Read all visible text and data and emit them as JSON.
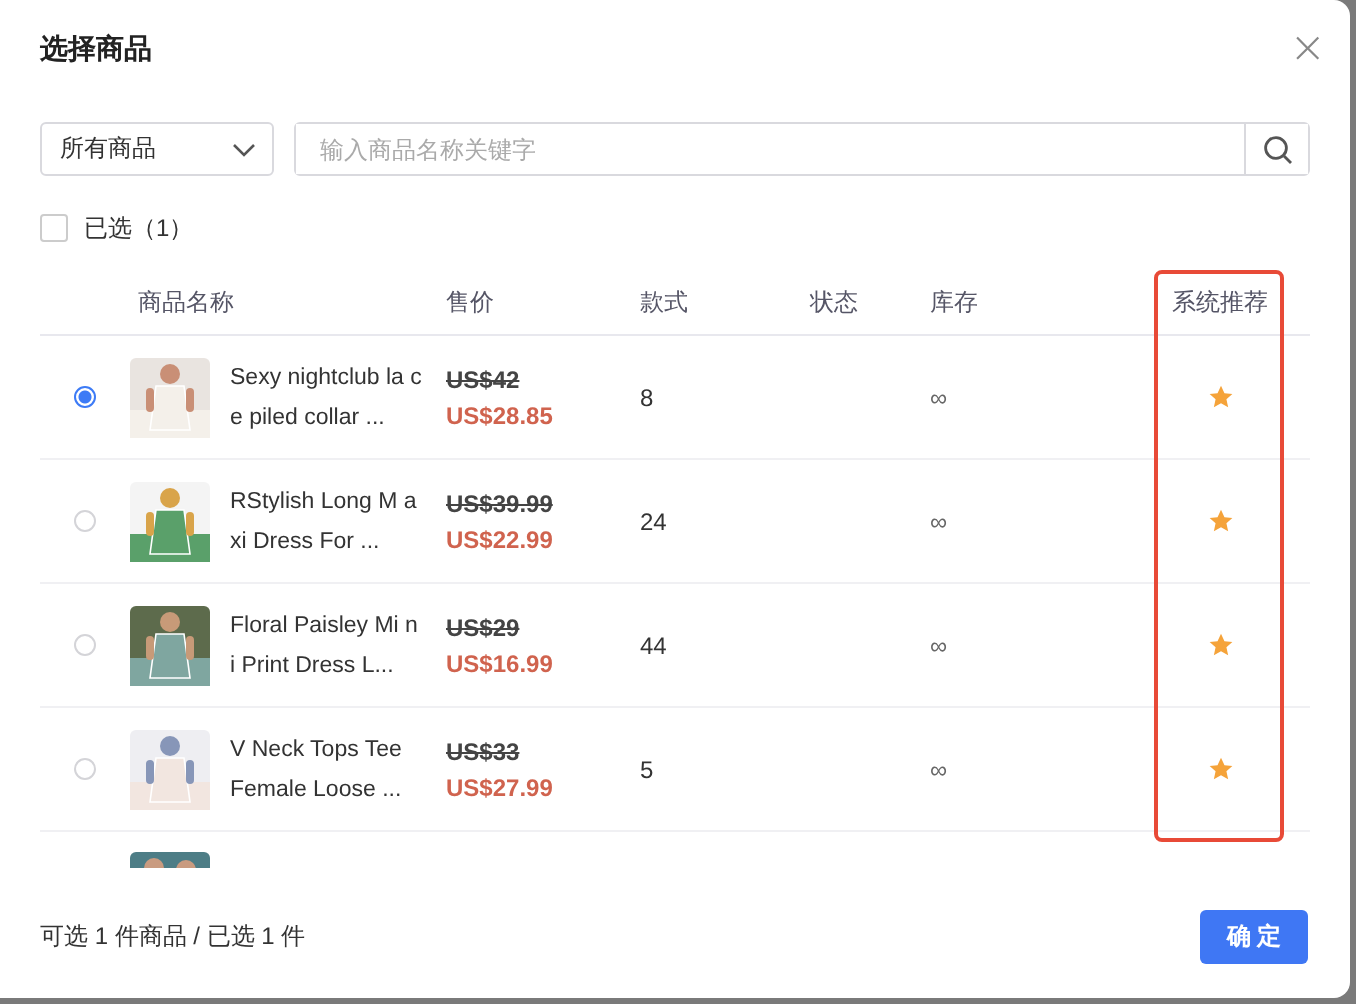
{
  "dialog": {
    "title": "选择商品",
    "close": "×"
  },
  "filter": {
    "category": "所有商品",
    "search_placeholder": "输入商品名称关键字"
  },
  "select_all": {
    "label": "已选（1）",
    "checked": false
  },
  "table": {
    "columns": [
      {
        "label": "商品名称",
        "highlighted": false
      },
      {
        "label": "售价",
        "highlighted": false
      },
      {
        "label": "款式",
        "highlighted": false
      },
      {
        "label": "状态",
        "highlighted": false
      },
      {
        "label": "库存",
        "highlighted": false
      },
      {
        "label": "系统推荐",
        "highlighted": true
      }
    ],
    "rows": [
      {
        "selected": true,
        "name": "Sexy nightclub la ce piled collar ...",
        "original_price": "US$42",
        "price": "US$28.85",
        "styles": "8",
        "stock": "∞",
        "recommended": true
      },
      {
        "selected": false,
        "name": "RStylish Long M axi Dress For ...",
        "original_price": "US$39.99",
        "price": "US$22.99",
        "styles": "24",
        "stock": "∞",
        "recommended": true
      },
      {
        "selected": false,
        "name": "Floral Paisley Mi ni Print Dress L...",
        "original_price": "US$29",
        "price": "US$16.99",
        "styles": "44",
        "stock": "∞",
        "recommended": true
      },
      {
        "selected": false,
        "name": "V Neck Tops Tee Female Loose ...",
        "original_price": "US$33",
        "price": "US$27.99",
        "styles": "5",
        "stock": "∞",
        "recommended": true
      }
    ]
  },
  "footer": {
    "summary": "可选 1 件商品 / 已选 1 件",
    "confirm": "确 定"
  }
}
